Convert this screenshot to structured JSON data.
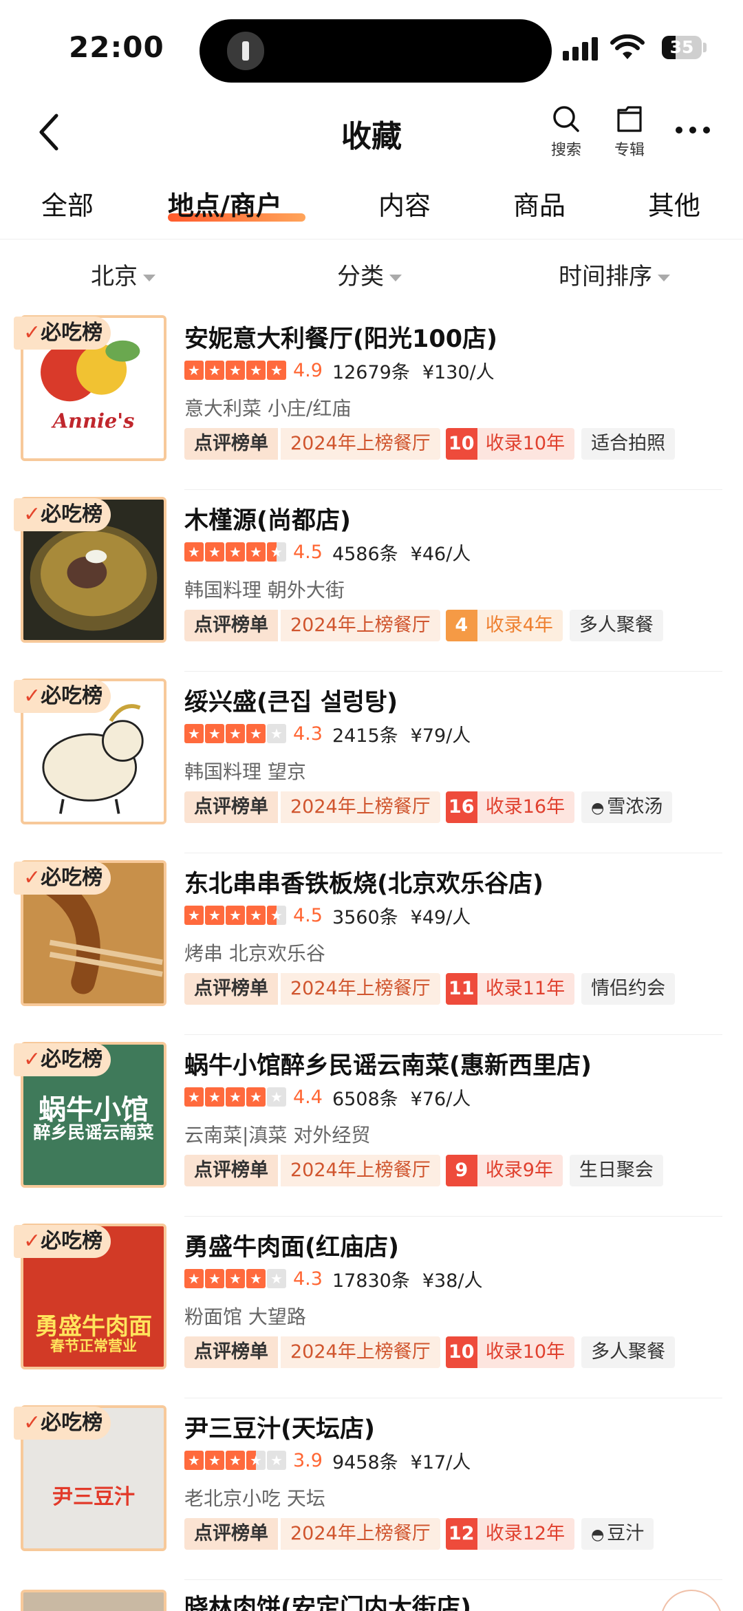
{
  "status_bar": {
    "time": "22:00",
    "battery": "35"
  },
  "header": {
    "title": "收藏",
    "search_label": "搜索",
    "album_label": "专辑"
  },
  "tabs": [
    {
      "label": "全部"
    },
    {
      "label": "地点/商户",
      "active": true
    },
    {
      "label": "内容"
    },
    {
      "label": "商品"
    },
    {
      "label": "其他"
    }
  ],
  "filters": {
    "city": "北京",
    "category": "分类",
    "sort": "时间排序"
  },
  "badge_label": "必吃榜",
  "colors": {
    "accent": "#ff6633",
    "star": "#ff6a3d",
    "rank_red": "#ee4b3b",
    "rank_orange": "#f59a45"
  },
  "items": [
    {
      "name": "安妮意大利餐厅(阳光100店)",
      "rating": 4.9,
      "stars": 5,
      "score": "4.9",
      "reviews": "12679条",
      "price": "¥130/人",
      "categories": "意大利菜 小庄/红庙",
      "tag_dp": "点评榜单",
      "tag_year": "2024年上榜餐厅",
      "rec_num": "10",
      "rec_label": "收录10年",
      "extra": "适合拍照"
    },
    {
      "name": "木槿源(尚都店)",
      "rating": 4.5,
      "stars": 4.5,
      "score": "4.5",
      "reviews": "4586条",
      "price": "¥46/人",
      "categories": "韩国料理 朝外大街",
      "tag_dp": "点评榜单",
      "tag_year": "2024年上榜餐厅",
      "rec_num": "4",
      "rec_label": "收录4年",
      "extra": "多人聚餐"
    },
    {
      "name": "绥兴盛(큰집 설렁탕)",
      "rating": 4.3,
      "stars": 4,
      "score": "4.3",
      "reviews": "2415条",
      "price": "¥79/人",
      "categories": "韩国料理 望京",
      "tag_dp": "点评榜单",
      "tag_year": "2024年上榜餐厅",
      "rec_num": "16",
      "rec_label": "收录16年",
      "extra": "雪浓汤"
    },
    {
      "name": "东北串串香铁板烧(北京欢乐谷店)",
      "rating": 4.5,
      "stars": 4.5,
      "score": "4.5",
      "reviews": "3560条",
      "price": "¥49/人",
      "categories": "烤串 北京欢乐谷",
      "tag_dp": "点评榜单",
      "tag_year": "2024年上榜餐厅",
      "rec_num": "11",
      "rec_label": "收录11年",
      "extra": "情侣约会"
    },
    {
      "name": "蜗牛小馆醉乡民谣云南菜(惠新西里店)",
      "rating": 4.4,
      "stars": 4,
      "score": "4.4",
      "reviews": "6508条",
      "price": "¥76/人",
      "categories": "云南菜|滇菜 对外经贸",
      "tag_dp": "点评榜单",
      "tag_year": "2024年上榜餐厅",
      "rec_num": "9",
      "rec_label": "收录9年",
      "extra": "生日聚会",
      "thumb_text": "蜗牛小馆",
      "thumb_sub": "醉乡民谣云南菜"
    },
    {
      "name": "勇盛牛肉面(红庙店)",
      "rating": 4.3,
      "stars": 4,
      "score": "4.3",
      "reviews": "17830条",
      "price": "¥38/人",
      "categories": "粉面馆 大望路",
      "tag_dp": "点评榜单",
      "tag_year": "2024年上榜餐厅",
      "rec_num": "10",
      "rec_label": "收录10年",
      "extra": "多人聚餐",
      "thumb_text": "勇盛牛肉面",
      "thumb_sub": "春节正常营业"
    },
    {
      "name": "尹三豆汁(天坛店)",
      "rating": 3.9,
      "stars": 3.5,
      "score": "3.9",
      "reviews": "9458条",
      "price": "¥17/人",
      "categories": "老北京小吃 天坛",
      "tag_dp": "点评榜单",
      "tag_year": "2024年上榜餐厅",
      "rec_num": "12",
      "rec_label": "收录12年",
      "extra": "豆汁",
      "thumb_text": "尹三豆汁"
    }
  ],
  "partial_item": {
    "name": "晓林肉饼(安定门内大街店)"
  }
}
